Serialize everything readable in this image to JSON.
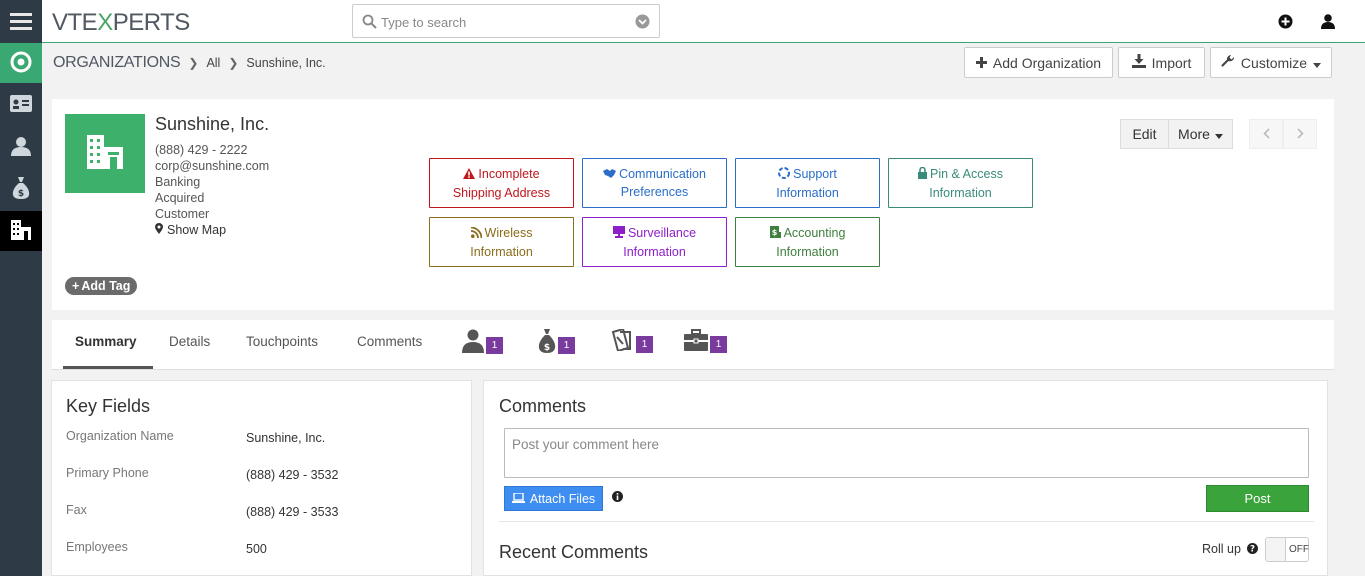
{
  "app": {
    "logo_left": "VTE",
    "logo_x": "X",
    "logo_right": "PERTS"
  },
  "search": {
    "placeholder": "Type to search"
  },
  "sidebar": {
    "items": [
      {
        "icon": "menu-icon"
      },
      {
        "icon": "target-icon",
        "active_color": "#3aa873"
      },
      {
        "icon": "contact-card-icon"
      },
      {
        "icon": "person-icon"
      },
      {
        "icon": "money-bag-icon"
      },
      {
        "icon": "organization-icon"
      }
    ]
  },
  "breadcrumb": {
    "module": "ORGANIZATIONS",
    "filter": "All",
    "record": "Sunshine, Inc."
  },
  "toolbar": {
    "add_label": "Add Organization",
    "import_label": "Import",
    "customize_label": "Customize"
  },
  "record": {
    "name": "Sunshine, Inc.",
    "phone": "(888) 429 - 2222",
    "email": "corp@sunshine.com",
    "industry": "Banking",
    "status": "Acquired",
    "type": "Customer",
    "map_label": "Show Map",
    "add_tag": "Add Tag",
    "edit_label": "Edit",
    "more_label": "More"
  },
  "widgets": [
    {
      "line1": "Incomplete",
      "line2": "Shipping Address",
      "color": "#c0171d",
      "icon": "warning-icon"
    },
    {
      "line1": "Communication",
      "line2": "Preferences",
      "color": "#2a6ec7",
      "icon": "handshake-icon"
    },
    {
      "line1": "Support",
      "line2": "Information",
      "color": "#2a6ec7",
      "icon": "life-ring-icon"
    },
    {
      "line1": "Pin & Access",
      "line2": "Information",
      "color": "#3a8c7a",
      "icon": "lock-icon"
    },
    {
      "line1": "Wireless",
      "line2": "Information",
      "color": "#8a6d1a",
      "icon": "rss-icon"
    },
    {
      "line1": "Surveillance",
      "line2": "Information",
      "color": "#8e1ec7",
      "icon": "monitor-icon"
    },
    {
      "line1": "Accounting",
      "line2": "Information",
      "color": "#3f7f3f",
      "icon": "ledger-icon"
    }
  ],
  "tabs": [
    {
      "label": "Summary"
    },
    {
      "label": "Details"
    },
    {
      "label": "Touchpoints"
    },
    {
      "label": "Comments"
    }
  ],
  "related": [
    {
      "icon": "contacts-icon",
      "count": "1"
    },
    {
      "icon": "deals-icon",
      "count": "1"
    },
    {
      "icon": "tickets-icon",
      "count": "1"
    },
    {
      "icon": "projects-icon",
      "count": "1"
    }
  ],
  "key_fields": {
    "title": "Key Fields",
    "rows": [
      {
        "label": "Organization Name",
        "value": "Sunshine, Inc."
      },
      {
        "label": "Primary Phone",
        "value": "(888) 429 - 3532"
      },
      {
        "label": "Fax",
        "value": "(888) 429 - 3533"
      },
      {
        "label": "Employees",
        "value": "500"
      }
    ]
  },
  "comments": {
    "title": "Comments",
    "placeholder": "Post your comment here",
    "attach_label": "Attach Files",
    "post_label": "Post",
    "recent_title": "Recent Comments",
    "rollup_label": "Roll up",
    "toggle_label": "OFF"
  }
}
